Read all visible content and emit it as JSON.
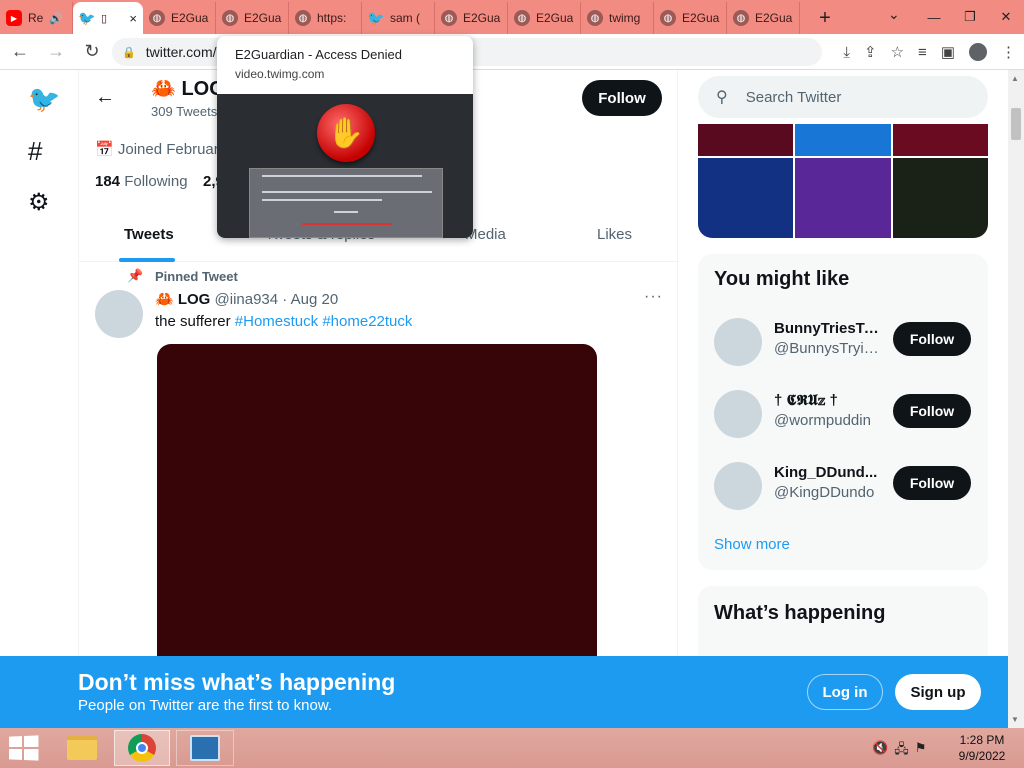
{
  "browser": {
    "tabs": [
      {
        "title": "Re",
        "icon": "youtube-icon",
        "audio": true
      },
      {
        "title": "",
        "icon": "twitter-icon",
        "active": true
      },
      {
        "title": "E2Gua",
        "icon": "globe-icon"
      },
      {
        "title": "E2Gua",
        "icon": "globe-icon"
      },
      {
        "title": "https:",
        "icon": "globe-icon"
      },
      {
        "title": "sam (",
        "icon": "twitter-icon"
      },
      {
        "title": "E2Gua",
        "icon": "globe-icon"
      },
      {
        "title": "E2Gua",
        "icon": "globe-icon"
      },
      {
        "title": "twimg",
        "icon": "globe-icon"
      },
      {
        "title": "E2Gua",
        "icon": "globe-icon"
      },
      {
        "title": "E2Gua",
        "icon": "globe-icon"
      }
    ],
    "url": "twitter.com/",
    "tab_close": "×",
    "new_tab": "+",
    "tab_dropdown": "⌄",
    "minimize": "—",
    "restore": "❐",
    "close": "✕"
  },
  "tooltip": {
    "title": "E2Guardian - Access Denied",
    "url": "video.twimg.com"
  },
  "profile": {
    "name": "🦀 LOG",
    "tweet_count": "309 Tweets",
    "follow_label": "Follow",
    "joined": "Joined February",
    "following_count": "184",
    "following_label": "Following",
    "followers_partial": "2,9"
  },
  "tabs": {
    "tweets": "Tweets",
    "replies": "Tweets & replies",
    "media": "Media",
    "likes": "Likes"
  },
  "tweet": {
    "pinned": "Pinned Tweet",
    "author_name": "🦀 LOG",
    "handle": "@iina934",
    "date": "· Aug 20",
    "text_plain": "the sufferer",
    "tag1": "#Homestuck",
    "tag2": "#home22tuck",
    "more": "···"
  },
  "search": {
    "placeholder": "Search Twitter"
  },
  "media_grid_colors": [
    "#5a0a1e",
    "#1877d6",
    "#6b0b22",
    "#123183",
    "#5a2799",
    "#1a2218"
  ],
  "might_like": {
    "title": "You might like",
    "suggestions": [
      {
        "name": "BunnyTriesTo...",
        "handle": "@BunnysTryin...",
        "button": "Follow"
      },
      {
        "name": "† 𝕮𝕽𝖀𝕫 †",
        "handle": "@wormpuddin",
        "button": "Follow"
      },
      {
        "name": "King_DDund...",
        "handle": "@KingDDundo",
        "button": "Follow"
      }
    ],
    "show_more": "Show more"
  },
  "happening": {
    "title": "What’s happening"
  },
  "banner": {
    "title": "Don’t miss what’s happening",
    "subtitle": "People on Twitter are the first to know.",
    "login": "Log in",
    "signup": "Sign up"
  },
  "taskbar": {
    "time": "1:28 PM",
    "date": "9/9/2022"
  },
  "colors": {
    "tab_strip": "#f28b82",
    "twitter_blue": "#1d9bf0",
    "tweet_media": "#370508"
  }
}
